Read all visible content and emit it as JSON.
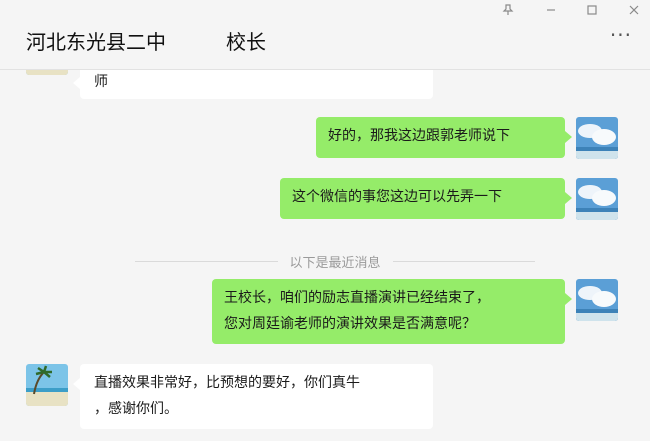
{
  "header": {
    "chat_name": "河北东光县二中",
    "contact_role": "校长",
    "more_label": "···"
  },
  "window_controls": {
    "pin_icon": "pin-icon",
    "minimize_icon": "minimize-icon",
    "maximize_icon": "maximize-icon",
    "close_icon": "close-icon"
  },
  "messages": [
    {
      "sender": "other",
      "lines": [
        "师"
      ]
    },
    {
      "sender": "me",
      "lines": [
        "好的，那我这边跟郭老师说下"
      ]
    },
    {
      "sender": "me",
      "lines": [
        "这个微信的事您这边可以先弄一下"
      ]
    },
    {
      "sender": "me",
      "lines": [
        "王校长，咱们的励志直播演讲已经结束了，",
        "您对周廷谕老师的演讲效果是否满意呢？"
      ]
    },
    {
      "sender": "other",
      "lines": [
        "直播效果非常好，比预想的要好，你们真牛",
        "，感谢你们。"
      ]
    }
  ],
  "divider_text": "以下是最近消息",
  "colors": {
    "my_bubble": "#95ec69",
    "other_bubble": "#ffffff",
    "background": "#f5f5f5"
  }
}
